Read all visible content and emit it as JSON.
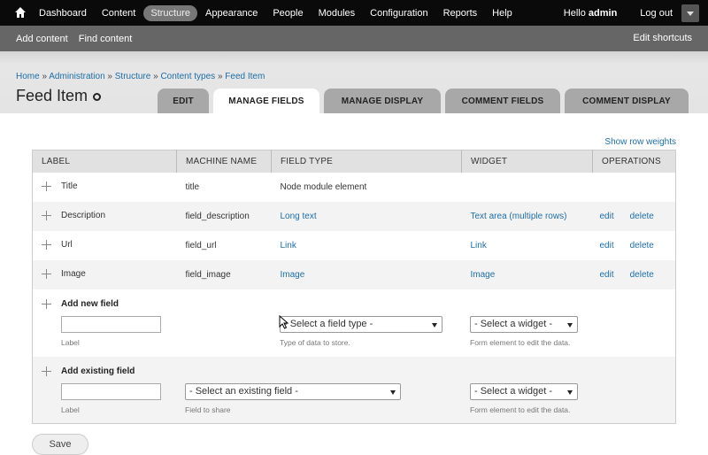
{
  "toolbar": {
    "items": [
      "Dashboard",
      "Content",
      "Structure",
      "Appearance",
      "People",
      "Modules",
      "Configuration",
      "Reports",
      "Help"
    ],
    "hello_prefix": "Hello ",
    "username": "admin",
    "logout": "Log out"
  },
  "shortcuts": {
    "add_content": "Add content",
    "find_content": "Find content",
    "edit_shortcuts": "Edit shortcuts"
  },
  "breadcrumb": [
    "Home",
    "Administration",
    "Structure",
    "Content types",
    "Feed Item"
  ],
  "breadcrumb_separator": "»",
  "page_title": "Feed Item",
  "tabs": [
    "EDIT",
    "MANAGE FIELDS",
    "MANAGE DISPLAY",
    "COMMENT FIELDS",
    "COMMENT DISPLAY"
  ],
  "show_row_weights": "Show row weights",
  "table": {
    "headers": [
      "LABEL",
      "MACHINE NAME",
      "FIELD TYPE",
      "WIDGET",
      "OPERATIONS"
    ],
    "rows": [
      {
        "label": "Title",
        "machine": "title",
        "type": "Node module element",
        "widget": "",
        "edit": "",
        "delete": ""
      },
      {
        "label": "Description",
        "machine": "field_description",
        "type": "Long text",
        "widget": "Text area (multiple rows)",
        "edit": "edit",
        "delete": "delete"
      },
      {
        "label": "Url",
        "machine": "field_url",
        "type": "Link",
        "widget": "Link",
        "edit": "edit",
        "delete": "delete"
      },
      {
        "label": "Image",
        "machine": "field_image",
        "type": "Image",
        "widget": "Image",
        "edit": "edit",
        "delete": "delete"
      }
    ]
  },
  "add_new": {
    "title": "Add new field",
    "label_hint": "Label",
    "type_select": "- Select a field type -",
    "type_hint": "Type of data to store.",
    "widget_select": "- Select a widget -",
    "widget_hint": "Form element to edit the data."
  },
  "add_existing": {
    "title": "Add existing field",
    "label_hint": "Label",
    "field_select": "- Select an existing field -",
    "field_hint": "Field to share",
    "widget_select": "- Select a widget -",
    "widget_hint": "Form element to edit the data."
  },
  "save_label": "Save"
}
